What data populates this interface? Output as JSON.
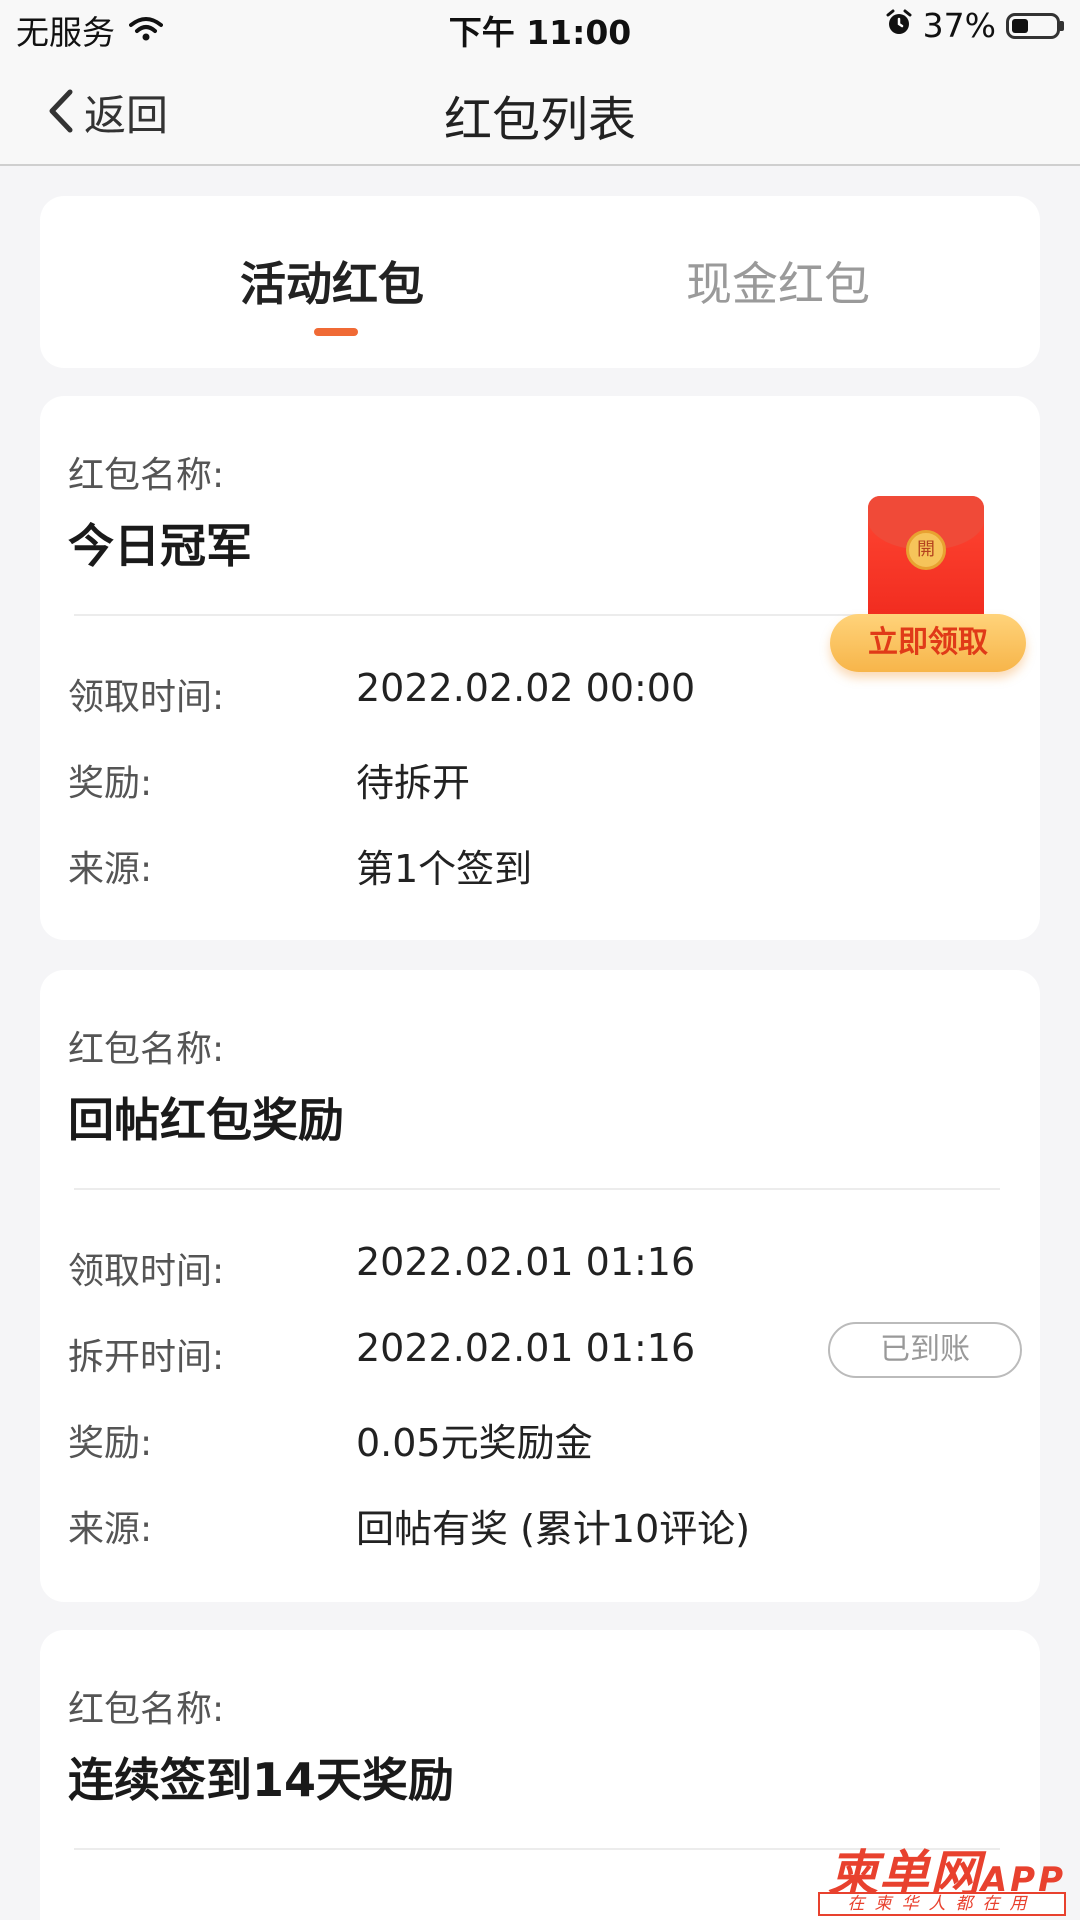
{
  "status_bar": {
    "carrier": "无服务",
    "time": "下午 11:00",
    "battery_text": "37%",
    "battery_level": 0.37
  },
  "nav": {
    "back_label": "返回",
    "title": "红包列表"
  },
  "tabs": [
    {
      "label": "活动红包",
      "active": true
    },
    {
      "label": "现金红包",
      "active": false
    }
  ],
  "cards": [
    {
      "name_label": "红包名称:",
      "name": "今日冠军",
      "rows": [
        {
          "label": "领取时间:",
          "value": "2022.02.02 00:00"
        },
        {
          "label": "奖励:",
          "value": "待拆开"
        },
        {
          "label": "来源:",
          "value": "第1个签到"
        }
      ],
      "action": {
        "coin_text": "開",
        "button_label": "立即领取"
      }
    },
    {
      "name_label": "红包名称:",
      "name": "回帖红包奖励",
      "rows": [
        {
          "label": "领取时间:",
          "value": "2022.02.01 01:16"
        },
        {
          "label": "拆开时间:",
          "value": "2022.02.01 01:16"
        },
        {
          "label": "奖励:",
          "value": "0.05元奖励金"
        },
        {
          "label": "来源:",
          "value": "回帖有奖 (累计10评论)"
        }
      ],
      "status": "已到账"
    },
    {
      "name_label": "红包名称:",
      "name": "连续签到14天奖励"
    }
  ],
  "watermark": {
    "brand": "柬单网",
    "app": "APP",
    "slogan": "在柬华人都在用"
  },
  "colors": {
    "accent": "#f06a35",
    "red": "#f02a1e",
    "gold": "#f7b54a"
  }
}
